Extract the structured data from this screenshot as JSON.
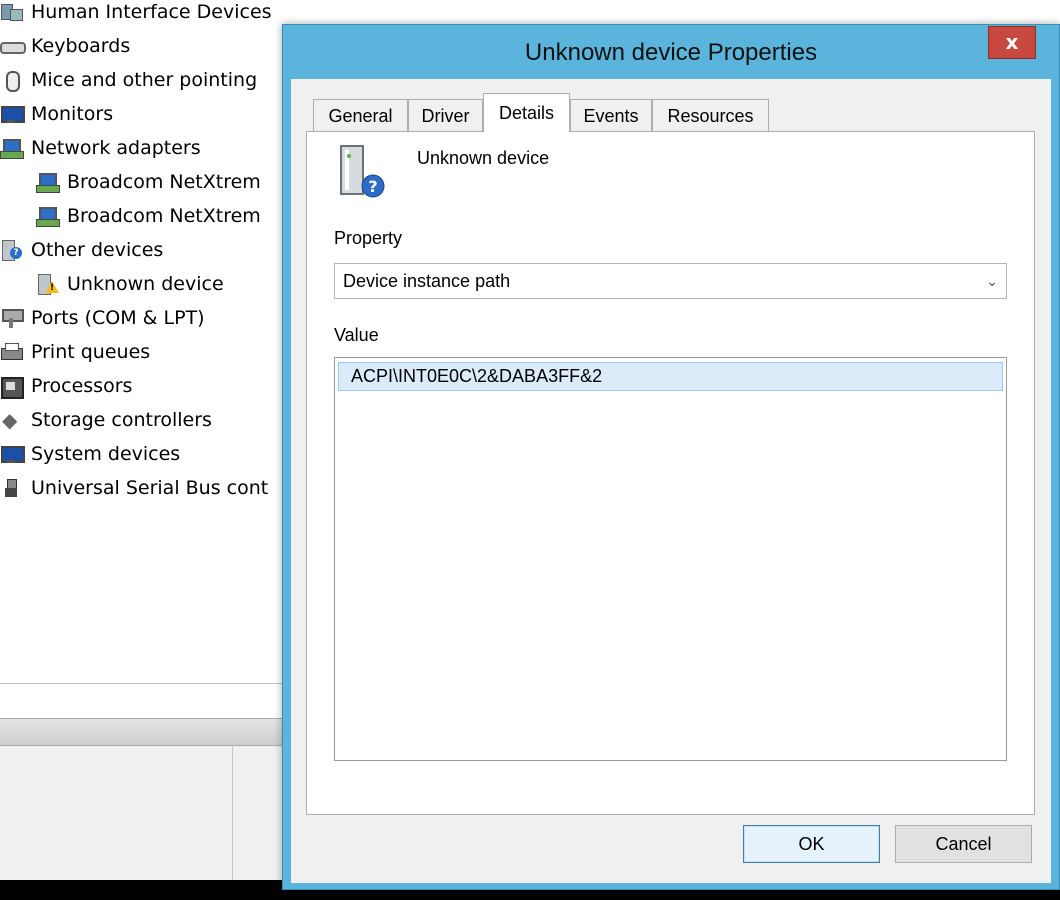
{
  "device_manager": {
    "tree": [
      {
        "label": "Human Interface Devices",
        "icon": "hid-icon"
      },
      {
        "label": "Keyboards",
        "icon": "keyboard-icon"
      },
      {
        "label": "Mice and other pointing",
        "icon": "mouse-icon"
      },
      {
        "label": "Monitors",
        "icon": "monitor-icon"
      },
      {
        "label": "Network adapters",
        "icon": "network-adapter-icon"
      },
      {
        "label": "Broadcom NetXtrem",
        "icon": "network-adapter-icon"
      },
      {
        "label": "Broadcom NetXtrem",
        "icon": "network-adapter-disabled-icon"
      },
      {
        "label": "Other devices",
        "icon": "other-devices-icon"
      },
      {
        "label": "Unknown device",
        "icon": "unknown-device-warning-icon"
      },
      {
        "label": "Ports (COM & LPT)",
        "icon": "port-icon"
      },
      {
        "label": "Print queues",
        "icon": "printer-icon"
      },
      {
        "label": "Processors",
        "icon": "processor-icon"
      },
      {
        "label": "Storage controllers",
        "icon": "storage-controller-icon"
      },
      {
        "label": "System devices",
        "icon": "system-device-icon"
      },
      {
        "label": "Universal Serial Bus cont",
        "icon": "usb-icon"
      }
    ]
  },
  "dialog": {
    "title": "Unknown device Properties",
    "close_label": "x",
    "tabs": [
      {
        "label": "General"
      },
      {
        "label": "Driver"
      },
      {
        "label": "Details"
      },
      {
        "label": "Events"
      },
      {
        "label": "Resources"
      }
    ],
    "active_tab": "Details",
    "device_name": "Unknown device",
    "property_label": "Property",
    "property_selected": "Device instance path",
    "value_label": "Value",
    "value_items": [
      "ACPI\\INT0E0C\\2&DABA3FF&2"
    ],
    "ok_label": "OK",
    "cancel_label": "Cancel"
  }
}
